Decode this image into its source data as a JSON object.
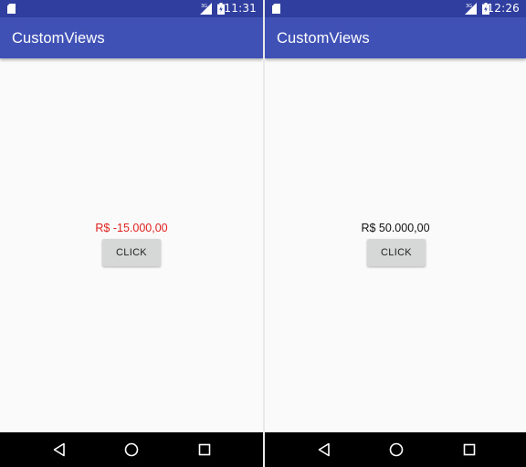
{
  "app": {
    "title": "CustomViews"
  },
  "screens": [
    {
      "status_bar": {
        "time": "11:31",
        "network": "3G"
      },
      "amount": {
        "text": "R$ -15.000,00",
        "color": "#e0201e"
      },
      "button_label": "CLICK"
    },
    {
      "status_bar": {
        "time": "12:26",
        "network": "3G"
      },
      "amount": {
        "text": "R$ 50.000,00",
        "color": "#111111"
      },
      "button_label": "CLICK"
    }
  ],
  "colors": {
    "status_bar": "#303f9f",
    "app_bar": "#3f51b5",
    "background": "#fafafa",
    "button": "#d6d7d7",
    "nav_bar": "#000000"
  },
  "icons": {
    "status": [
      "sd-card-icon",
      "signal-icon",
      "battery-charging-icon"
    ],
    "nav": [
      "back-icon",
      "home-icon",
      "recents-icon"
    ]
  }
}
